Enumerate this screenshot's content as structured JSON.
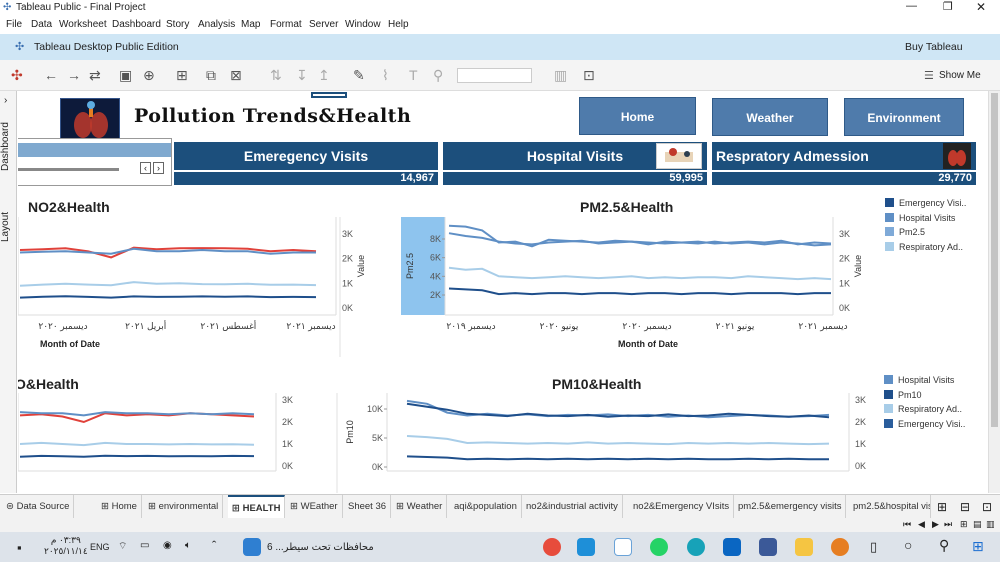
{
  "window": {
    "title": "Tableau Public - Final Project",
    "edition": "Tableau Desktop Public Edition",
    "buy_label": "Buy Tableau"
  },
  "menu": [
    "File",
    "Data",
    "Worksheet",
    "Dashboard",
    "Story",
    "Analysis",
    "Map",
    "Format",
    "Server",
    "Window",
    "Help"
  ],
  "toolbar": {
    "show_me": "Show Me"
  },
  "left_rail": {
    "dashboard_tab": "Dashboard",
    "layout_tab": "Layout"
  },
  "dashboard": {
    "title": "Pollution Trends&Health",
    "nav": {
      "home": "Home",
      "weather": "Weather",
      "environment": "Environment"
    },
    "kpis": [
      {
        "label": "Emeregency Visits",
        "value": "14,967"
      },
      {
        "label": "Hospital Visits",
        "value": "59,995"
      },
      {
        "label": "Respratory Admession",
        "value": "29,770"
      }
    ],
    "legend_top": [
      "Emergency Visi..",
      "Hospital Visits",
      "Pm2.5",
      "Respiratory Ad.."
    ],
    "legend_bottom": [
      "Hospital Visits",
      "Pm10",
      "Respiratory Ad..",
      "Emergency Visi.."
    ]
  },
  "colors": {
    "dark_blue": "#1f4f8b",
    "mid_blue": "#5f8fc5",
    "light_blue": "#a8cde8",
    "red": "#e0413a",
    "kpi_bg": "#1c4f7c",
    "nav_bg": "#4f7bab"
  },
  "chart_data": [
    {
      "type": "line",
      "title": "NO2&Health",
      "xlabel": "Month of Date",
      "y2label": "Value",
      "x_ticks": [
        "ديسمبر ٢٠٢٠",
        "أبريل ٢٠٢١",
        "أغسطس ٢٠٢١",
        "ديسمبر ٢٠٢١"
      ],
      "y2_ticks": [
        "3K",
        "2K",
        "1K",
        "0K"
      ],
      "y2lim": [
        0,
        3000
      ],
      "series": [
        {
          "values": [
            2350,
            2380,
            2420,
            2300,
            2050,
            2450,
            2380,
            2420,
            2430,
            2420,
            2400,
            2300,
            2350,
            2300
          ],
          "color": "red"
        },
        {
          "values": [
            2250,
            2280,
            2300,
            2250,
            2200,
            2400,
            2300,
            2300,
            2350,
            2300,
            2300,
            2200,
            2250,
            2250
          ],
          "color": "mid_blue"
        },
        {
          "values": [
            900,
            950,
            980,
            950,
            920,
            1050,
            980,
            1000,
            970,
            960,
            980,
            940,
            950,
            930
          ],
          "color": "light_blue"
        },
        {
          "values": [
            420,
            460,
            480,
            450,
            420,
            470,
            450,
            460,
            470,
            460,
            470,
            440,
            450,
            440
          ],
          "color": "dark_blue"
        }
      ]
    },
    {
      "type": "line",
      "title": "PM2.5&Health",
      "xlabel": "Month of Date",
      "ylabel": "Pm2.5",
      "y2label": "Value",
      "x_ticks": [
        "ديسمبر ٢٠١٩",
        "يونيو ٢٠٢٠",
        "ديسمبر ٢٠٢٠",
        "يونيو ٢٠٢١",
        "ديسمبر ٢٠٢١"
      ],
      "y_ticks": [
        "8K",
        "6K",
        "4K",
        "2K"
      ],
      "y2_ticks": [
        "3K",
        "2K",
        "1K",
        "0K"
      ],
      "ylim": [
        0,
        9500
      ],
      "series": [
        {
          "values": [
            9000,
            8900,
            8500,
            7200,
            7300,
            6800,
            7500,
            7400,
            7300,
            7200,
            7400,
            7300,
            7000,
            7300,
            7200,
            7300,
            7100,
            7200,
            7300,
            7200,
            7400,
            7000,
            7200,
            7100
          ],
          "color": "mid_blue"
        },
        {
          "values": [
            8200,
            7900,
            7700,
            7300,
            7100,
            7000,
            7200,
            7300,
            7400,
            7100,
            7200,
            7300,
            7200,
            7100,
            7200,
            7100,
            7300,
            7100,
            7200,
            7000,
            7200,
            7100,
            6900,
            7000
          ],
          "color": "mid_blue"
        },
        {
          "values": [
            4500,
            4300,
            4400,
            3600,
            3500,
            3400,
            3500,
            3600,
            3500,
            3400,
            3500,
            3600,
            3400,
            3500,
            3400,
            3500,
            3500,
            3400,
            3600,
            3500,
            3400,
            3300,
            3400,
            3300
          ],
          "color": "light_blue"
        },
        {
          "values": [
            2300,
            2200,
            2100,
            1700,
            1800,
            1700,
            1800,
            1800,
            1700,
            1800,
            1800,
            1700,
            1800,
            1800,
            1700,
            1800,
            1800,
            1700,
            1800,
            1800,
            1800,
            1700,
            1800,
            1800
          ],
          "color": "dark_blue"
        }
      ]
    },
    {
      "type": "line",
      "title": "O&Health",
      "y2_ticks": [
        "3K",
        "2K",
        "1K",
        "0K"
      ],
      "y2lim": [
        0,
        3000
      ],
      "series": [
        {
          "values": [
            2300,
            2350,
            2250,
            2000,
            2400,
            2300,
            2350,
            2300,
            2400,
            2350,
            2300,
            2250
          ],
          "color": "red"
        },
        {
          "values": [
            2450,
            2400,
            2400,
            2300,
            2450,
            2400,
            2400,
            2350,
            2400,
            2350,
            2400,
            2350
          ],
          "color": "mid_blue"
        },
        {
          "values": [
            1000,
            1050,
            1000,
            950,
            1050,
            1000,
            1000,
            980,
            1000,
            980,
            990,
            970
          ],
          "color": "light_blue"
        },
        {
          "values": [
            420,
            460,
            440,
            420,
            470,
            450,
            460,
            440,
            450,
            440,
            460,
            450
          ],
          "color": "dark_blue"
        }
      ]
    },
    {
      "type": "line",
      "title": "PM10&Health",
      "ylabel": "Pm10",
      "y_ticks": [
        "10K",
        "5K",
        "0K"
      ],
      "y2_ticks": [
        "3K",
        "2K",
        "1K",
        "0K"
      ],
      "ylim": [
        0,
        12500
      ],
      "series": [
        {
          "values": [
            12000,
            11500,
            10000,
            9500,
            9800,
            9500,
            9700,
            9400,
            9600,
            9500,
            9700,
            9400,
            9600,
            9300,
            9500,
            9200,
            9400,
            9600,
            9500,
            9300,
            9400,
            9600
          ],
          "color": "mid_blue"
        },
        {
          "values": [
            11500,
            11000,
            10500,
            9800,
            9600,
            9400,
            9800,
            9500,
            9400,
            9600,
            9300,
            9500,
            9400,
            9700,
            9400,
            9500,
            9800,
            9600,
            9400,
            9300,
            9500,
            9200
          ],
          "color": "dark_blue"
        },
        {
          "values": [
            6000,
            5800,
            5500,
            4800,
            4900,
            4800,
            4700,
            4800,
            4700,
            4900,
            4700,
            4800,
            4700,
            4600,
            4800,
            4700,
            4800,
            4700,
            4800,
            4700,
            4600,
            4700
          ],
          "color": "light_blue"
        },
        {
          "values": [
            2500,
            2400,
            2300,
            2000,
            2100,
            2000,
            2100,
            2000,
            2100,
            2000,
            2100,
            2000,
            2100,
            2000,
            2100,
            2000,
            2000,
            2100,
            2000,
            2100,
            2000,
            2000
          ],
          "color": "dark_blue"
        }
      ]
    }
  ],
  "sheet_tabs": [
    "Data Source",
    "Home",
    "environmental",
    "HEALTH",
    "WEather",
    "Sheet 36",
    "Weather",
    "aqi&population",
    "no2&industrial activity",
    "no2&Emergency VIsits",
    "pm2.5&emergency visits",
    "pm2.5&hospital vis"
  ],
  "active_tab": "HEALTH",
  "taskbar": {
    "time": "٠٣:٣٩ م",
    "date": "٢٠٢٥/١١/١٤",
    "lang": "ENG",
    "news": "محافظات تحت سيطر... 6"
  }
}
